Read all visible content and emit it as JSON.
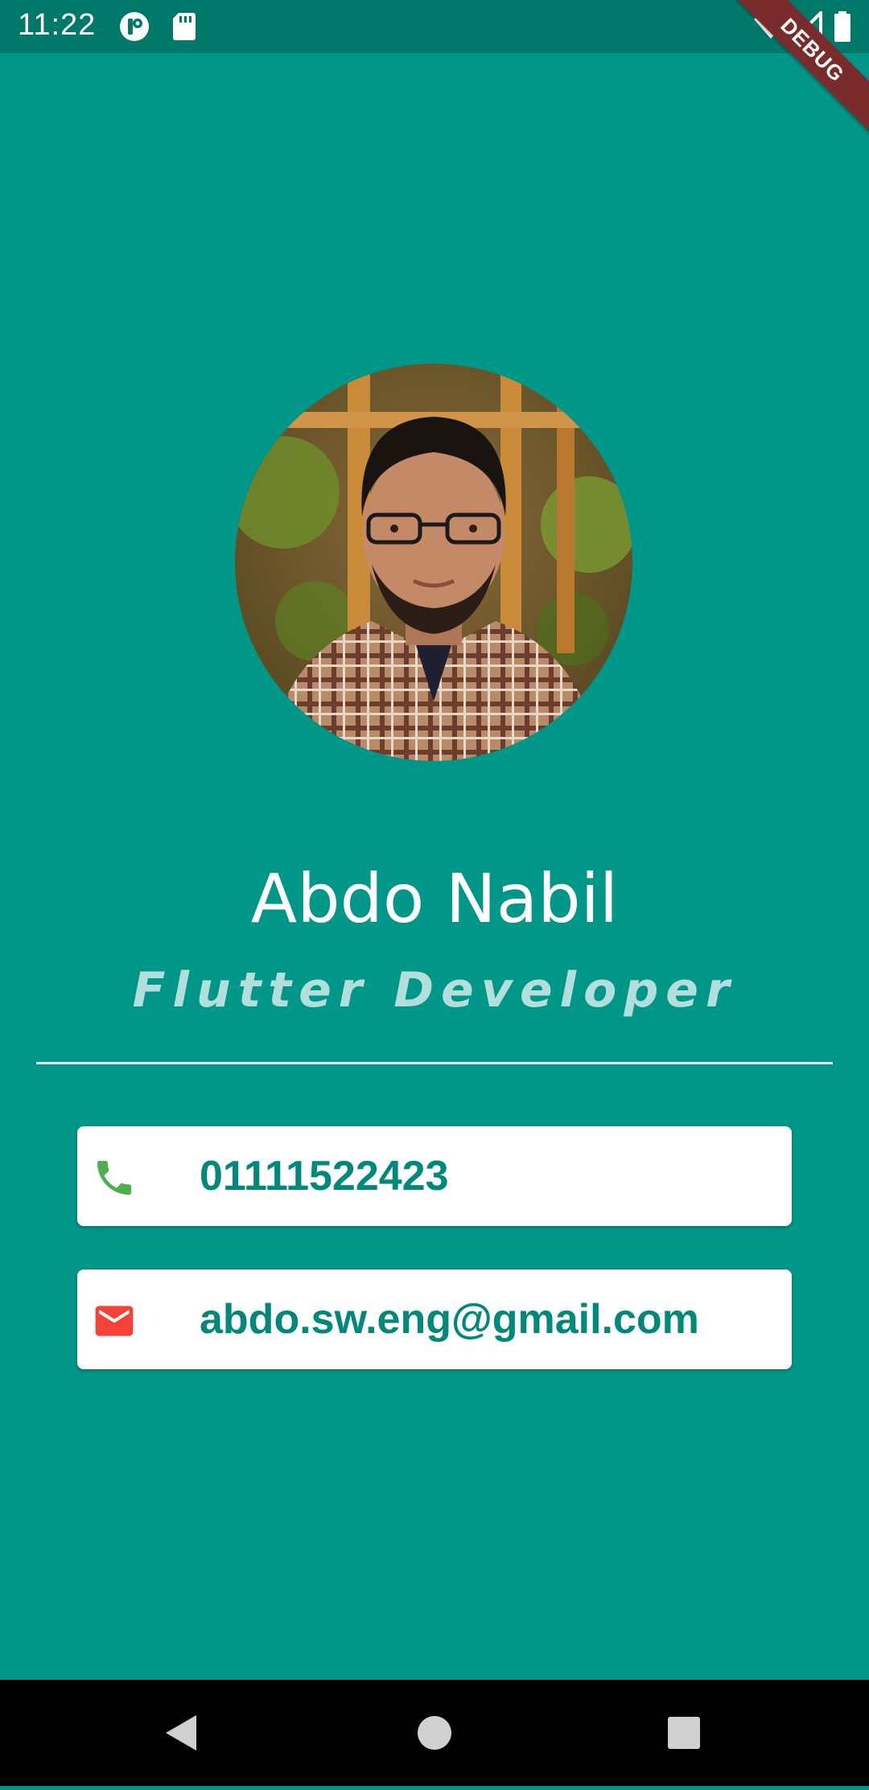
{
  "status_bar": {
    "time": "11:22",
    "icons": [
      "app-icon",
      "sd-card-icon",
      "wifi-icon",
      "signal-icon",
      "battery-icon"
    ]
  },
  "debug_banner": "DEBUG",
  "profile": {
    "name": "Abdo Nabil",
    "role": "Flutter Developer"
  },
  "contacts": [
    {
      "icon": "phone-icon",
      "value": "01111522423",
      "icon_color": "#4CAF50"
    },
    {
      "icon": "email-icon",
      "value": "abdo.sw.eng@gmail.com",
      "icon_color": "#F44336"
    }
  ],
  "nav_bar": {
    "buttons": [
      "back-icon",
      "home-icon",
      "recents-icon"
    ]
  },
  "colors": {
    "background": "#009688",
    "status_bar": "#00796B",
    "card_text": "#00897B",
    "role_text": "#B2DFDB"
  }
}
